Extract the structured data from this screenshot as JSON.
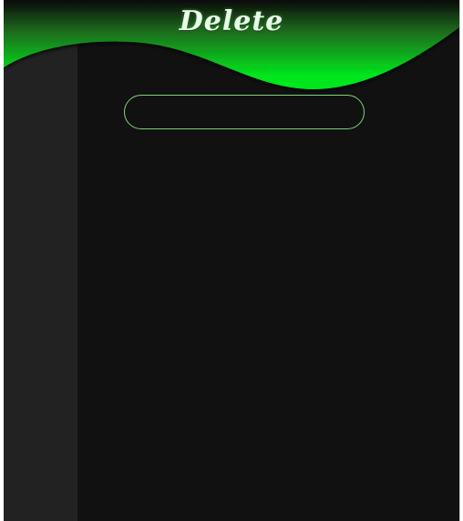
{
  "header": {
    "title": "Delete",
    "accent_color": "#00e61a"
  },
  "search": {
    "value": "",
    "placeholder": ""
  }
}
